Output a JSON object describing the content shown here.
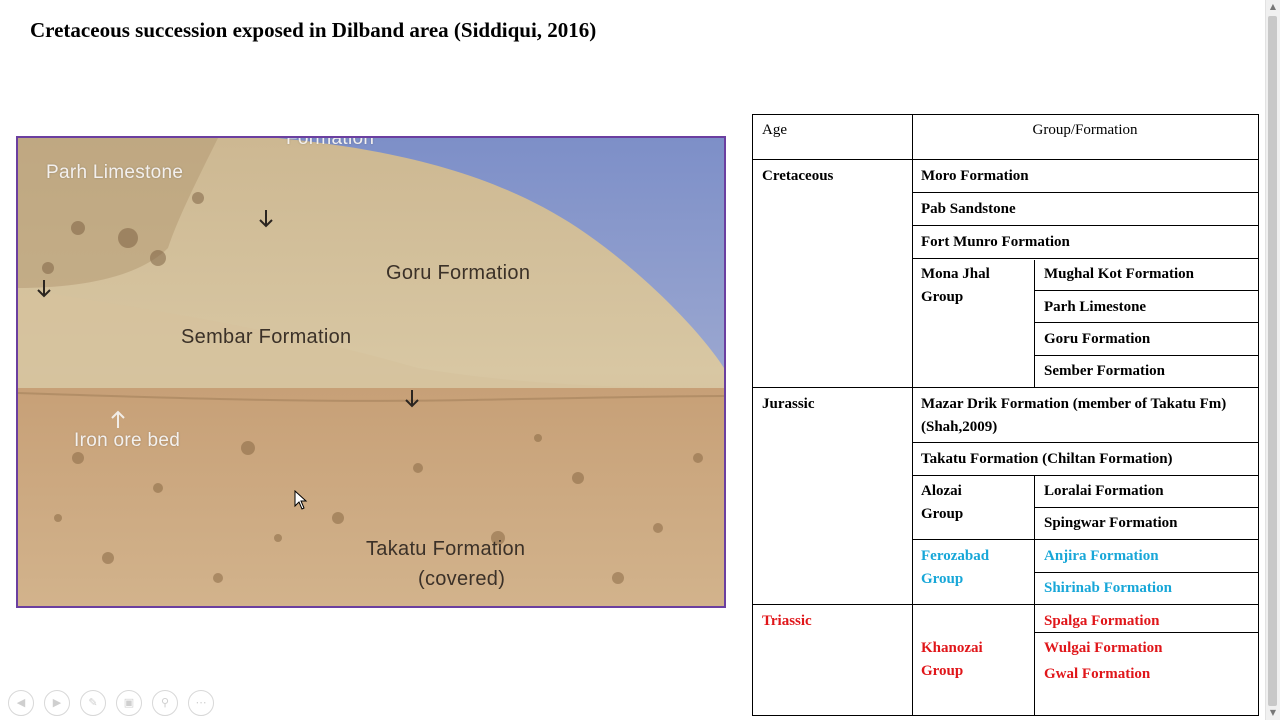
{
  "slide": {
    "title": "Cretaceous succession exposed in Dilband area (Siddiqui, 2016)"
  },
  "photo": {
    "labels": {
      "top_partial": "Formation",
      "parh": "Parh Limestone",
      "goru": "Goru Formation",
      "sembar": "Sembar Formation",
      "iron": "Iron ore bed",
      "takatu_1": "Takatu Formation",
      "takatu_2": "(covered)"
    }
  },
  "table": {
    "headers": {
      "age": "Age",
      "group": "Group/Formation"
    },
    "ages": {
      "cretaceous": "Cretaceous",
      "jurassic": "Jurassic",
      "triassic": "Triassic"
    },
    "groups": {
      "mona_jhal": "Mona Jhal Group",
      "alozai": "Alozai Group",
      "ferozabad": "Ferozabad Group",
      "khanozai": "Khanozai Group"
    },
    "formations": {
      "moro": "Moro Formation",
      "pab": "Pab Sandstone",
      "fort_munro": "Fort Munro Formation",
      "mughal_kot": "Mughal Kot Formation",
      "parh": "Parh Limestone",
      "goru": "Goru Formation",
      "sember": "Sember Formation",
      "mazar_drik": "Mazar Drik Formation (member of Takatu Fm)   (Shah,2009)",
      "takatu": "Takatu Formation (Chiltan Formation)",
      "loralai": "Loralai Formation",
      "spingwar": "Spingwar Formation",
      "anjira": "Anjira Formation",
      "shirinab": "Shirinab Formation",
      "spalga": "Spalga Formation",
      "wulgai": "Wulgai Formation",
      "gwal": "Gwal Formation"
    }
  },
  "colors": {
    "photo_border": "#6b3fa0",
    "jurassic_blue": "#18a7d8",
    "triassic_red": "#e0161a"
  },
  "controls": {
    "icons": [
      "previous-icon",
      "next-icon",
      "pen-icon",
      "slides-icon",
      "zoom-icon",
      "more-icon"
    ]
  }
}
